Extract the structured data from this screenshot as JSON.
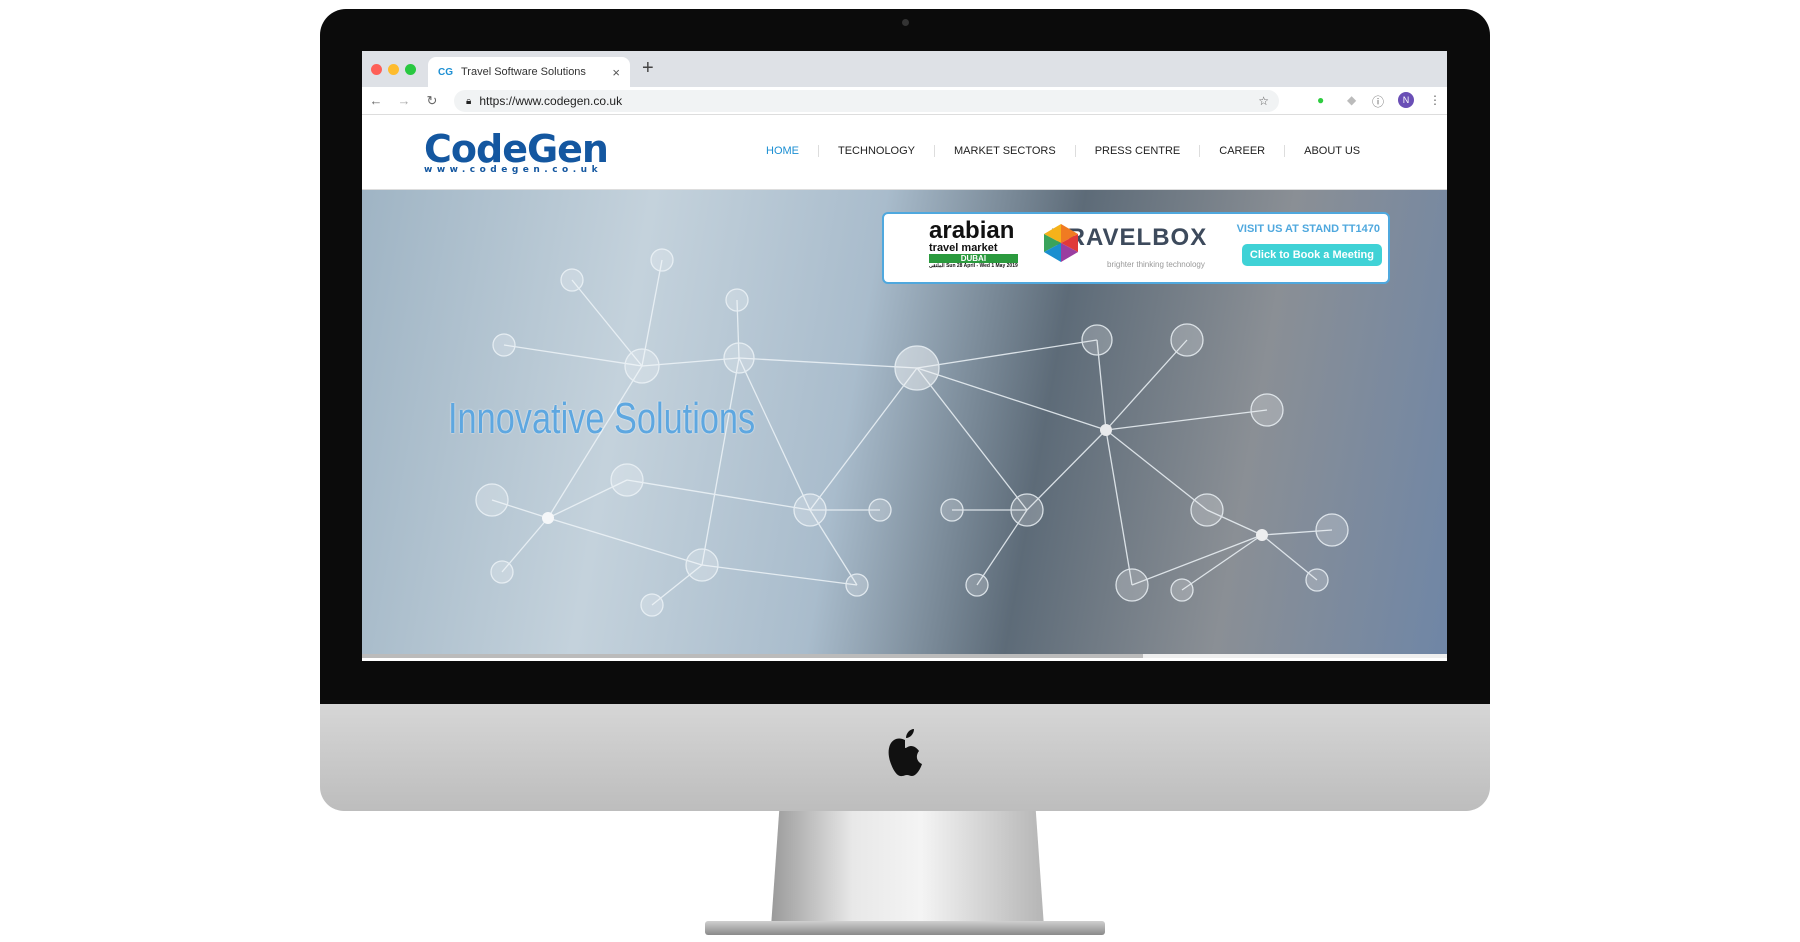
{
  "browser": {
    "tab_title": "Travel Software Solutions",
    "tab_favicon": "CG",
    "url": "https://www.codegen.co.uk",
    "avatar": "N"
  },
  "site": {
    "logo": "CodeGen",
    "logo_sub": "www.codegen.co.uk",
    "menu": [
      {
        "label": "HOME"
      },
      {
        "label": "TECHNOLOGY"
      },
      {
        "label": "MARKET SECTORS"
      },
      {
        "label": "PRESS CENTRE"
      },
      {
        "label": "CAREER"
      },
      {
        "label": "ABOUT US"
      }
    ],
    "headline": "Innovative Solutions",
    "banner": {
      "atm_title": "arabian",
      "atm_sub": "travel market",
      "atm_city": "DUBAI",
      "atm_arabic": "الملتقى",
      "atm_dates": "Sun 28 April - Wed 1 May 2019",
      "travelbox": "TRAVELBOX",
      "travelbox_tag": "brighter thinking technology",
      "visit": "VISIT US AT STAND TT1470",
      "cta": "Click to Book a Meeting"
    }
  },
  "colors": {
    "accent": "#1c8fd3",
    "logo": "#1457a0",
    "cta": "#3fd2d6"
  }
}
